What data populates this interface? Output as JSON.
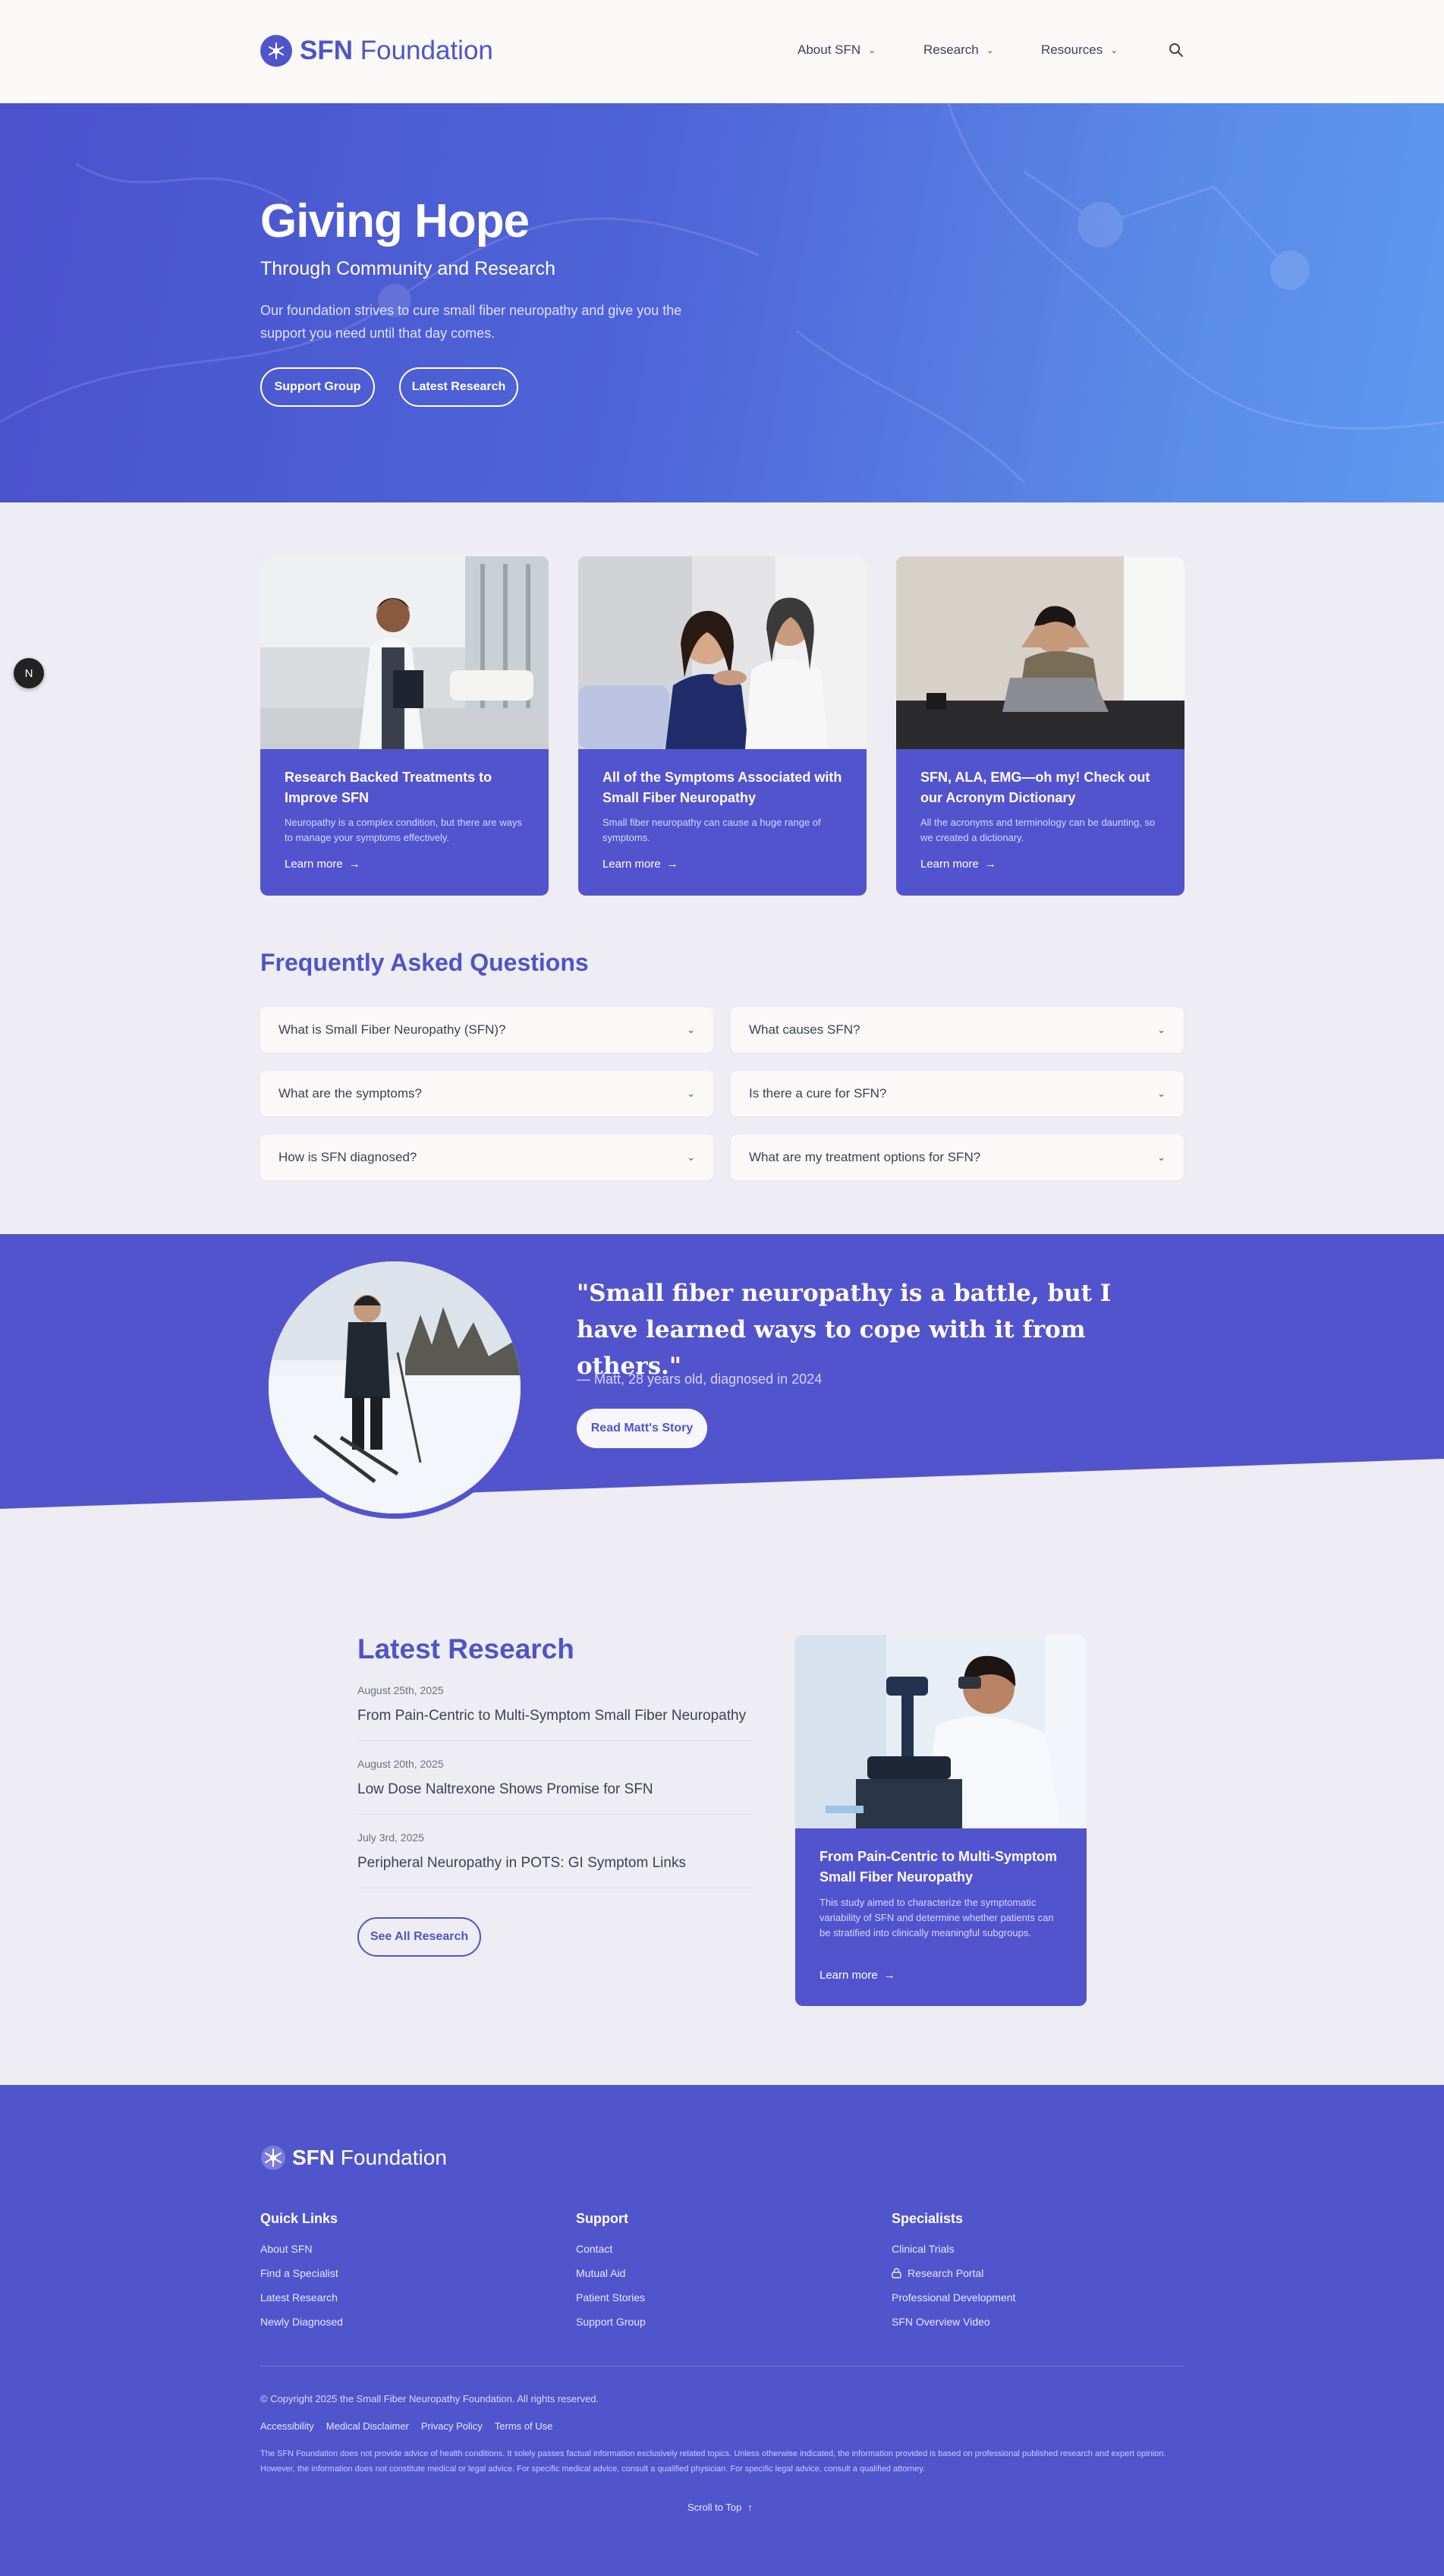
{
  "header": {
    "logo_bold": "SFN",
    "logo_rest": "Foundation",
    "nav": [
      {
        "label": "About SFN",
        "icon": "chevron-down-icon"
      },
      {
        "label": "Research",
        "icon": "chevron-down-icon"
      },
      {
        "label": "Resources",
        "icon": "chevron-down-icon"
      }
    ],
    "search_icon": "search-icon"
  },
  "hero": {
    "title": "Giving Hope",
    "subtitle": "Through Community and Research",
    "description": "Our foundation strives to cure small fiber neuropathy and give you the support you need until that day comes.",
    "buttons": [
      "Support Group",
      "Latest Research"
    ]
  },
  "cards": [
    {
      "title": "Research Backed Treatments to Improve SFN",
      "desc": "Neuropathy is a complex condition, but there are ways to manage your symptoms effectively.",
      "link": "Learn more"
    },
    {
      "title": "All of the Symptoms Associated with Small Fiber Neuropathy",
      "desc": "Small fiber neuropathy can cause a huge range of symptoms.",
      "link": "Learn more"
    },
    {
      "title": "SFN, ALA, EMG—oh my! Check out our Acronym Dictionary",
      "desc": "All the acronyms and terminology can be daunting, so we created a dictionary.",
      "link": "Learn more"
    }
  ],
  "faq": {
    "title": "Frequently Asked Questions",
    "items": [
      "What is Small Fiber Neuropathy (SFN)?",
      "What causes SFN?",
      "What are the symptoms?",
      "Is there a cure for SFN?",
      "How is SFN diagnosed?",
      "What are my treatment options for SFN?"
    ]
  },
  "testimonial": {
    "quote": "\"Small fiber neuropathy is a battle, but I have learned ways to cope with it from others.\"",
    "attribution": "— Matt, 28 years old, diagnosed in 2024",
    "button": "Read Matt's Story"
  },
  "latest_research": {
    "title": "Latest Research",
    "items": [
      {
        "date": "August 25th, 2025",
        "title": "From Pain-Centric to Multi-Symptom Small Fiber Neuropathy"
      },
      {
        "date": "August 20th, 2025",
        "title": "Low Dose Naltrexone Shows Promise for SFN"
      },
      {
        "date": "July 3rd, 2025",
        "title": "Peripheral Neuropathy in POTS: GI Symptom Links"
      }
    ],
    "button": "See All Research",
    "featured": {
      "title": "From Pain-Centric to Multi-Symptom Small Fiber Neuropathy",
      "desc": "This study aimed to characterize the symptomatic variability of SFN and determine whether patients can be stratified into clinically meaningful subgroups.",
      "link": "Learn more"
    }
  },
  "footer": {
    "logo_bold": "SFN",
    "logo_rest": "Foundation",
    "columns": [
      {
        "title": "Quick Links",
        "links": [
          "About SFN",
          "Find a Specialist",
          "Latest Research",
          "Newly Diagnosed"
        ]
      },
      {
        "title": "Support",
        "links": [
          "Contact",
          "Mutual Aid",
          "Patient Stories",
          "Support Group"
        ]
      },
      {
        "title": "Specialists",
        "links": [
          "Clinical Trials",
          "Research Portal",
          "Professional Development",
          "SFN Overview Video"
        ]
      }
    ],
    "copyright": "© Copyright 2025 the Small Fiber Neuropathy Foundation. All rights reserved.",
    "legal": [
      "Accessibility",
      "Medical Disclaimer",
      "Privacy Policy",
      "Terms of Use"
    ],
    "disclaimer": "The SFN Foundation does not provide advice of health conditions. It solely passes factual information exclusively related topics. Unless otherwise indicated, the information provided is based on professional published research and expert opinion. However, the information does not constitute medical or legal advice. For specific medical advice, consult a qualified physician. For specific legal advice, consult a qualified attorney.",
    "scroll_top": "Scroll to Top"
  },
  "fab_label": "N",
  "colors": {
    "brand": "#5055cc",
    "brand_dark": "#4f54c8",
    "background": "#eeedf4",
    "header_bg": "#faf9f8"
  }
}
